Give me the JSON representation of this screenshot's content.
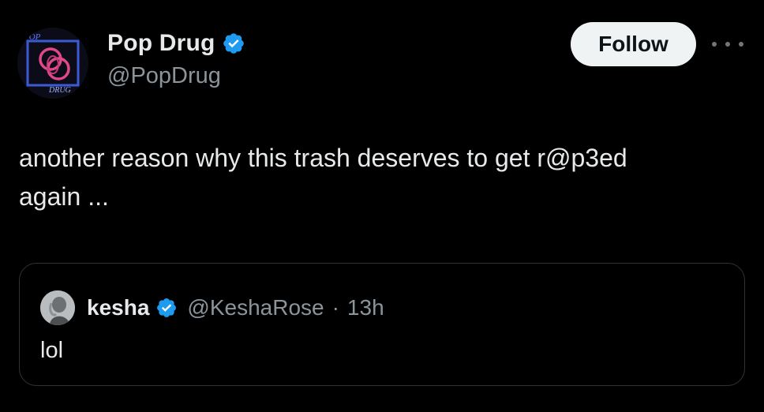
{
  "post": {
    "author": {
      "display_name": "Pop Drug",
      "handle": "@PopDrug",
      "verified": true,
      "avatar_logo_text": [
        "POP",
        "DRUG"
      ]
    },
    "follow_label": "Follow",
    "more_icon": "more-horizontal-icon",
    "text": "another reason why this trash deserves to get r@p3ed\nagain ...",
    "quoted": {
      "display_name": "kesha",
      "handle": "@KeshaRose",
      "separator": "·",
      "time": "13h",
      "verified": true,
      "text": "lol"
    }
  },
  "colors": {
    "background": "#000000",
    "text_primary": "#e7e9ea",
    "text_secondary": "#8b949b",
    "verified_blue": "#1d9bf0",
    "follow_bg": "#eff3f4",
    "border": "#2f3336"
  }
}
